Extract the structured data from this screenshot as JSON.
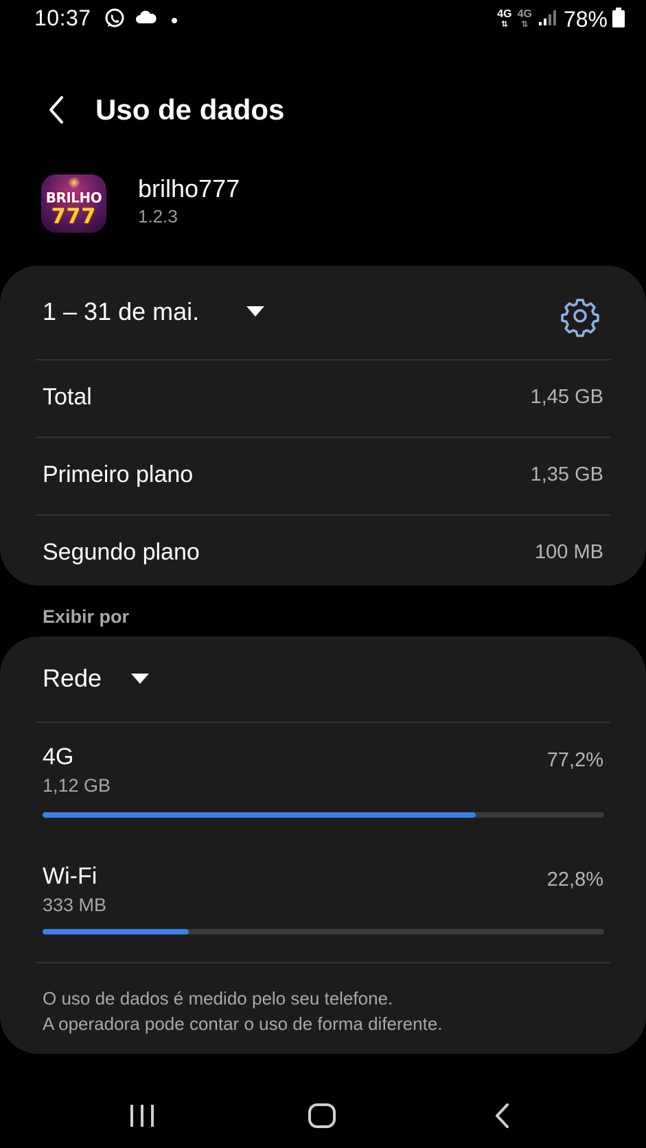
{
  "status_bar": {
    "time": "10:37",
    "net1_label": "4G",
    "net2_label": "4G",
    "battery": "78%",
    "icons": [
      "whatsapp-icon",
      "cloud-icon",
      "dot-icon",
      "signal-icon",
      "battery-icon"
    ]
  },
  "header": {
    "title": "Uso de dados",
    "back_icon": "chevron-left-icon"
  },
  "app": {
    "name": "brilho777",
    "version": "1.2.3",
    "logo_line1": "BRILHO",
    "logo_line2": "777"
  },
  "usage": {
    "period": "1 – 31 de mai.",
    "rows": [
      {
        "label": "Total",
        "value": "1,45 GB"
      },
      {
        "label": "Primeiro plano",
        "value": "1,35 GB"
      },
      {
        "label": "Segundo plano",
        "value": "100 MB"
      }
    ]
  },
  "view_by": {
    "section_label": "Exibir por",
    "selected": "Rede",
    "networks": [
      {
        "name": "4G",
        "size": "1,12 GB",
        "percent": "77,2%",
        "fraction": 0.772
      },
      {
        "name": "Wi-Fi",
        "size": "333 MB",
        "percent": "22,8%",
        "fraction": 0.26
      }
    ],
    "note_line1": "O uso de dados é medido pelo seu telefone.",
    "note_line2": "A operadora pode contar o uso de forma diferente."
  },
  "colors": {
    "background": "#000000",
    "card": "#1c1c1c",
    "accent": "#3f7fe9",
    "secondary_text": "#a8a8a8"
  }
}
